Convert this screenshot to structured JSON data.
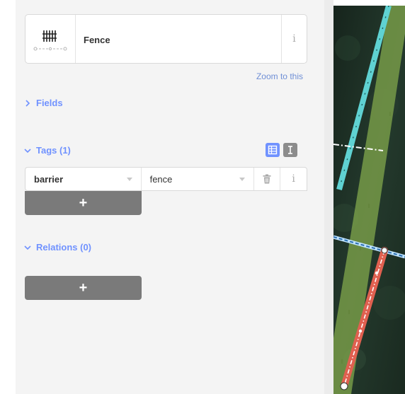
{
  "preset": {
    "name": "Fence",
    "info_glyph": "i",
    "icon": "fence-icon"
  },
  "zoom_link": "Zoom to this",
  "sections": {
    "fields": "Fields",
    "tags": "Tags (1)",
    "relations": "Relations (0)"
  },
  "tags": [
    {
      "key": "barrier",
      "value": "fence"
    }
  ],
  "tag_info_glyph": "i",
  "add_label": "+",
  "colors": {
    "accent": "#7092ff",
    "button": "#7a7a7a",
    "sidebar": "#f4f4f4",
    "selected_way": "#e06050",
    "green_area": "#7ea34a",
    "cyan_path": "#5fd2d2"
  }
}
